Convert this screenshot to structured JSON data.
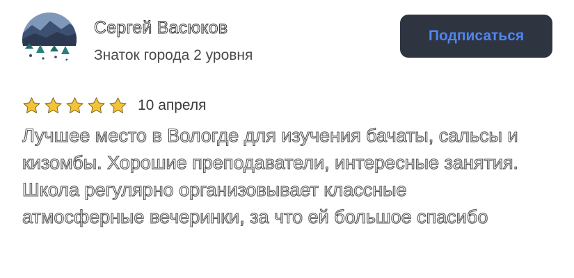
{
  "review": {
    "author": {
      "name": "Сергей Васюков",
      "level": "Знаток города 2 уровня",
      "avatar_icon": "mountain-landscape-avatar"
    },
    "subscribe_label": "Подписаться",
    "rating": 5,
    "rating_max": 5,
    "date": "10 апреля",
    "text": "Лучшее место в Вологде для изучения бачаты, сальсы и кизомбы. Хорошие преподаватели, интересные занятия. Школа регулярно организовывает классные атмосферные вечеринки, за что ей большое спасибо"
  },
  "colors": {
    "button_background": "#2f3441",
    "button_text": "#4d86f0",
    "star": "#f5c338",
    "text_outline": "#555555"
  }
}
